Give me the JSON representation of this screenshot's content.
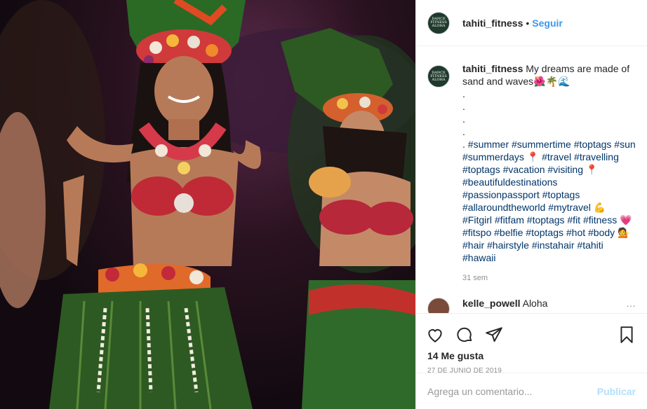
{
  "post": {
    "username": "tahiti_fitness",
    "separator": "•",
    "follow_label": "Seguir",
    "avatar_text": [
      "DANCE",
      "FITNESS",
      "ALOHA"
    ]
  },
  "caption": {
    "username": "tahiti_fitness",
    "line1": " My dreams are made of sand and waves🌺🌴🌊",
    "dots": [
      ".",
      ".",
      ".",
      "."
    ],
    "hashtags_text": ". #summer #summertime #toptags #sun #summerdays 📍 #travel #travelling #toptags #vacation #visiting 📍 #beautifuldestinations #passionpassport #toptags #allaroundtheworld #mytravel 💪 #Fitgirl #fitfam #toptags #fit #fitness 💗 #fitspo #belfie #toptags #hot #body 💁 #hair #hairstyle #instahair #tahiti #hawaii",
    "time": "31 sem"
  },
  "comment": {
    "username": "kelle_powell",
    "text": " Aloha",
    "more": "…"
  },
  "actions": {
    "likes": "14 Me gusta",
    "date": "27 DE JUNIO DE 2019",
    "comment_placeholder": "Agrega un comentario...",
    "publish_label": "Publicar"
  },
  "icons": [
    "heart-icon",
    "comment-icon",
    "share-icon",
    "bookmark-icon"
  ],
  "colors": {
    "link": "#3897f0",
    "hashtag": "#003569",
    "muted": "#8e8e8e",
    "publish_disabled": "#b2dffc"
  }
}
